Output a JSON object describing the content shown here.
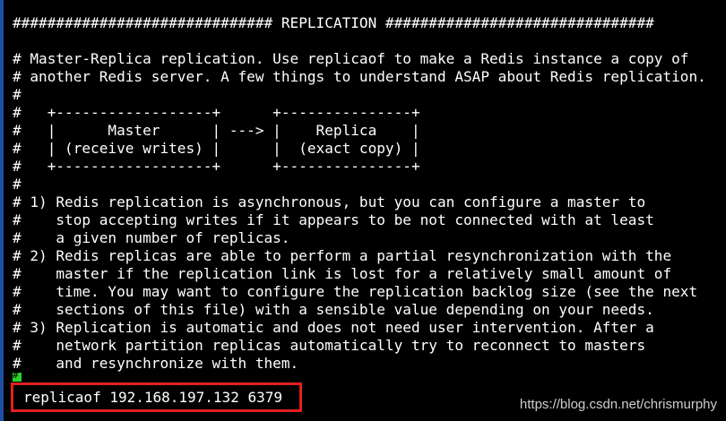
{
  "terminal": {
    "background_color": "#000000",
    "text_color": "#ffffff",
    "lines": [
      "############################## REPLICATION ###############################",
      "",
      "# Master-Replica replication. Use replicaof to make a Redis instance a copy of",
      "# another Redis server. A few things to understand ASAP about Redis replication.",
      "#",
      "#   +------------------+      +---------------+",
      "#   |      Master      | ---> |    Replica    |",
      "#   | (receive writes) |      |  (exact copy) |",
      "#   +------------------+      +---------------+",
      "#",
      "# 1) Redis replication is asynchronous, but you can configure a master to",
      "#    stop accepting writes if it appears to be not connected with at least",
      "#    a given number of replicas.",
      "# 2) Redis replicas are able to perform a partial resynchronization with the",
      "#    master if the replication link is lost for a relatively small amount of",
      "#    time. You may want to configure the replication backlog size (see the next",
      "#    sections of this file) with a sensible value depending on your needs.",
      "# 3) Replication is automatic and does not need user intervention. After a",
      "#    network partition replicas automatically try to reconnect to masters",
      "#    and resynchronize with them."
    ],
    "prompt_marker": "#",
    "command_line": "replicaof 192.168.197.132 6379",
    "highlight_color": "#e02020"
  },
  "watermark": {
    "text": "https://blog.csdn.net/chrismurphy"
  }
}
